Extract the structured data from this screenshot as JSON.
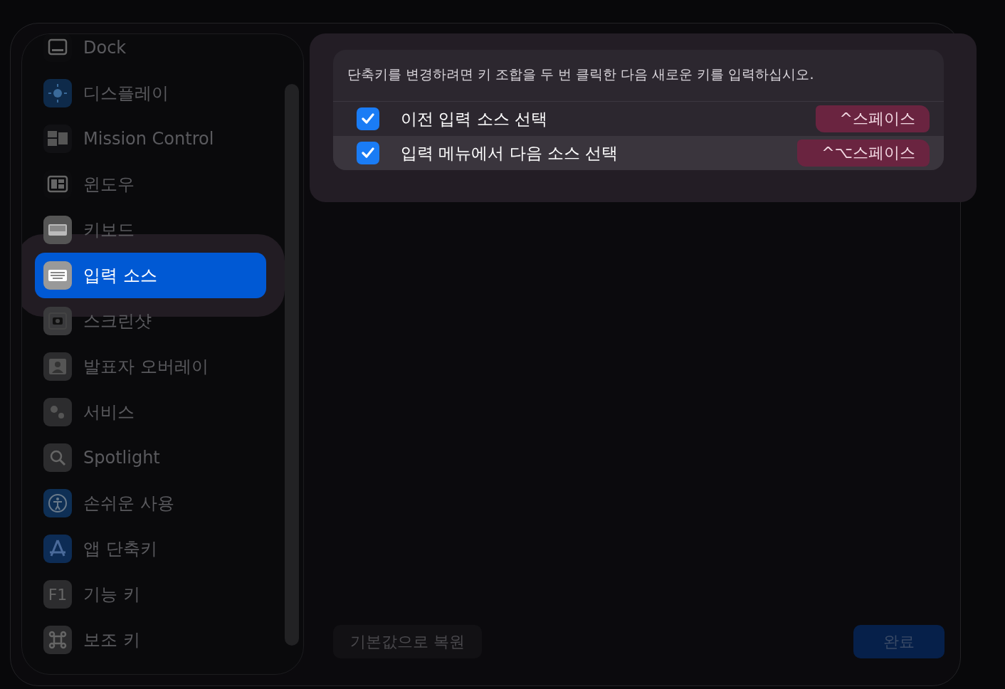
{
  "sidebar": {
    "items": [
      {
        "label": "Dock",
        "selected": false
      },
      {
        "label": "디스플레이",
        "selected": false
      },
      {
        "label": "Mission Control",
        "selected": false
      },
      {
        "label": "윈도우",
        "selected": false
      },
      {
        "label": "키보드",
        "selected": false
      },
      {
        "label": "입력 소스",
        "selected": true
      },
      {
        "label": "스크린샷",
        "selected": false
      },
      {
        "label": "발표자 오버레이",
        "selected": false
      },
      {
        "label": "서비스",
        "selected": false
      },
      {
        "label": "Spotlight",
        "selected": false
      },
      {
        "label": "손쉬운 사용",
        "selected": false
      },
      {
        "label": "앱 단축키",
        "selected": false
      },
      {
        "label": "기능 키",
        "selected": false,
        "icon_text": "F1"
      },
      {
        "label": "보조 키",
        "selected": false
      }
    ]
  },
  "shortcuts": {
    "description": "단축키를 변경하려면 키 조합을 두 번 클릭한 다음 새로운 키를 입력하십시오.",
    "rows": [
      {
        "label": "이전 입력 소스 선택",
        "checked": true,
        "shortcut": "^스페이스"
      },
      {
        "label": "입력 메뉴에서 다음 소스 선택",
        "checked": true,
        "shortcut": "^⌥스페이스"
      }
    ]
  },
  "footer": {
    "restore_button": "기본값으로 복원",
    "done_button": "완료"
  }
}
